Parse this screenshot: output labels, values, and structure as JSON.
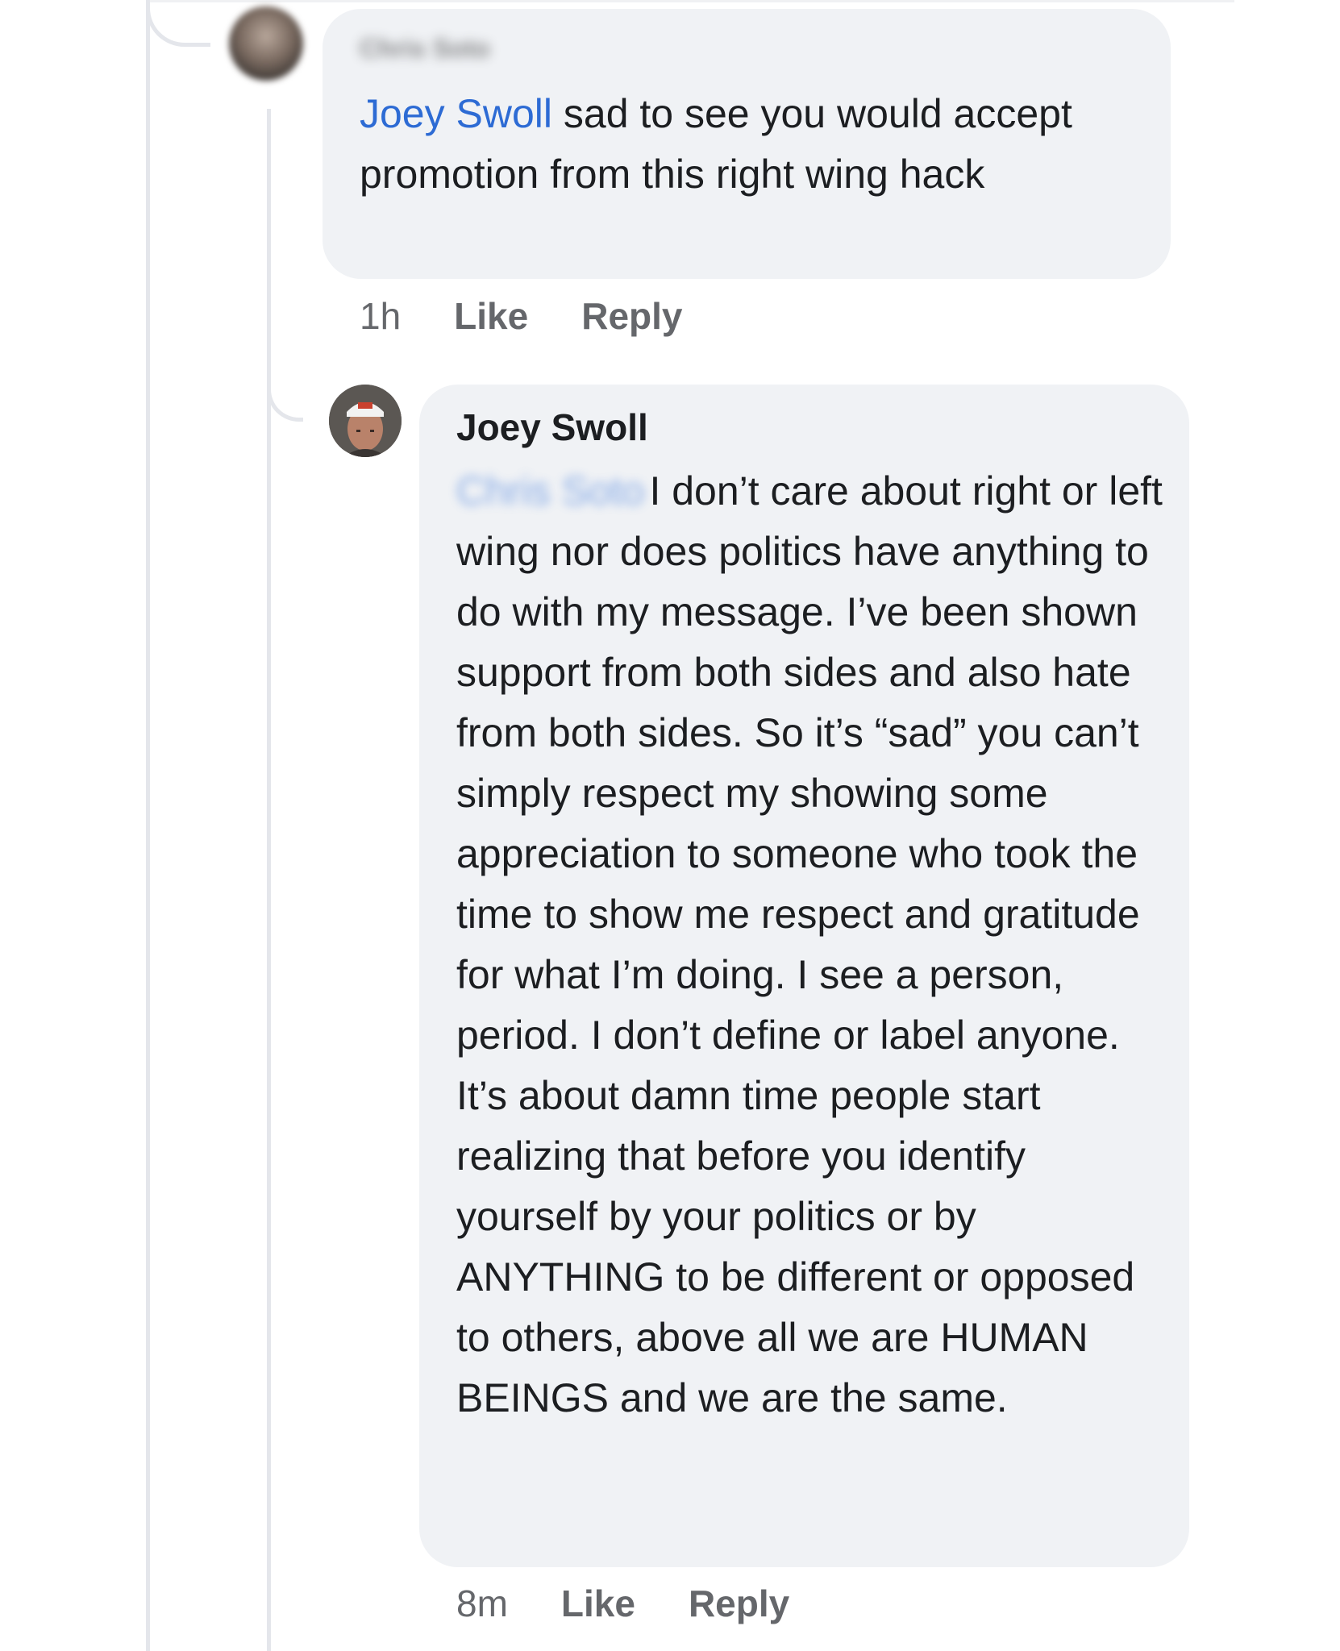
{
  "comments": [
    {
      "author": "Chris Soto",
      "mention": "Joey Swoll",
      "text": " sad to see you would accept promotion from this right wing hack",
      "time": "1h",
      "like_label": "Like",
      "reply_label": "Reply"
    },
    {
      "author": "Joey Swoll",
      "mention": "Chris Soto",
      "text": "I don’t care about right or left wing nor does politics have anything to do with my message. I’ve been shown support from both sides and also hate from both sides. So it’s “sad” you can’t simply respect my showing some appreciation to someone who took the time to show me respect and gratitude for what I’m doing. I see a person, period. I don’t define or label anyone. It’s about damn time people start realizing that before you identify yourself by your politics or by ANYTHING to be different or opposed to others, above all we are HUMAN BEINGS and we are the same.",
      "time": "8m",
      "like_label": "Like",
      "reply_label": "Reply"
    }
  ],
  "colors": {
    "bubble": "#f0f2f5",
    "mention": "#2d6bd4",
    "meta_text": "#65676b",
    "thread_line": "#e4e6eb"
  },
  "icons": {
    "comment_1_avatar": "profile-photo-blurred",
    "comment_2_avatar": "profile-photo-man-white-cap"
  }
}
